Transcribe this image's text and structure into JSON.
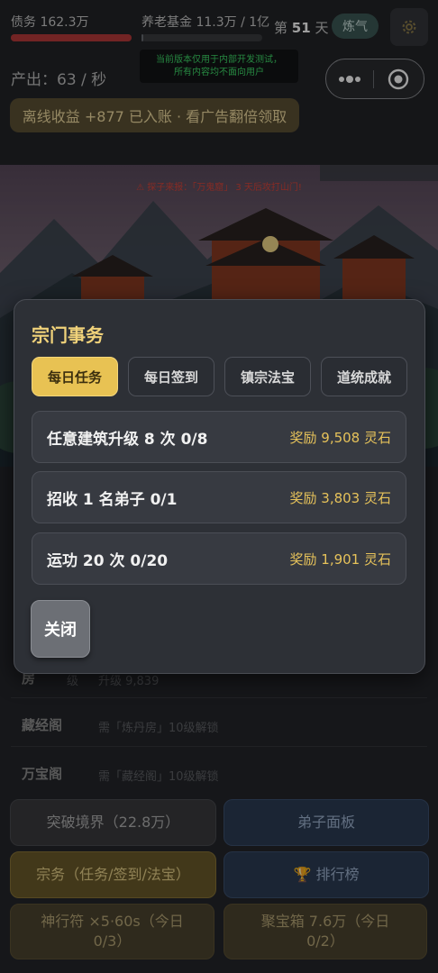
{
  "header": {
    "debt": "债务 162.3万",
    "pension": "养老基金 11.3万 / 1亿",
    "pension_progress_percent": 1.13,
    "day_prefix": "第",
    "day_number": "51",
    "day_suffix": "天",
    "realm_badge": "炼气",
    "notice_line1": "当前版本仅用于内部开发测试，",
    "notice_line2": "所有内容均不面向用户",
    "output": "产出：63 / 秒",
    "offline_reward": "离线收益 +877 已入账 · 看广告翻倍领取"
  },
  "scene": {
    "warning": "⚠ 探子来报：「万鬼窟」 3 天后攻打山门!"
  },
  "background": {
    "row_fang_name": "房",
    "row_fang_level": "级",
    "row_fang_desc": "升级 9,839",
    "row_cangjing_name": "藏经阁",
    "row_cangjing_desc": "需「炼丹房」10级解锁",
    "row_wanbao_name": "万宝阁",
    "row_wanbao_desc": "需「藏经阁」10级解锁",
    "btn_breakthrough": "突破境界（22.8万）",
    "btn_disciples": "弟子面板",
    "btn_sect": "宗务（任务/签到/法宝）",
    "btn_ranking": "🏆 排行榜",
    "btn_talisman": "神行符 ×5·60s（今日 0/3）",
    "btn_treasure": "聚宝箱 7.6万（今日 0/2）"
  },
  "modal": {
    "title": "宗门事务",
    "tabs": [
      "每日任务",
      "每日签到",
      "镇宗法宝",
      "道统成就"
    ],
    "active_tab": 0,
    "tasks": [
      {
        "name": "任意建筑升级 8 次 0/8",
        "reward": "奖励 9,508 灵石"
      },
      {
        "name": "招收 1 名弟子 0/1",
        "reward": "奖励 3,803 灵石"
      },
      {
        "name": "运功 20 次 0/20",
        "reward": "奖励 1,901 灵石"
      }
    ],
    "close_label": "关闭"
  },
  "colors": {
    "accent_gold": "#e8c253",
    "reward_gold": "#e6c25a",
    "notice_green": "#3fdc6a",
    "warning_red": "#d9463b"
  },
  "icons": {
    "settings": "gear-icon",
    "capsule_more": "more-dots-icon",
    "capsule_close": "target-close-icon"
  }
}
